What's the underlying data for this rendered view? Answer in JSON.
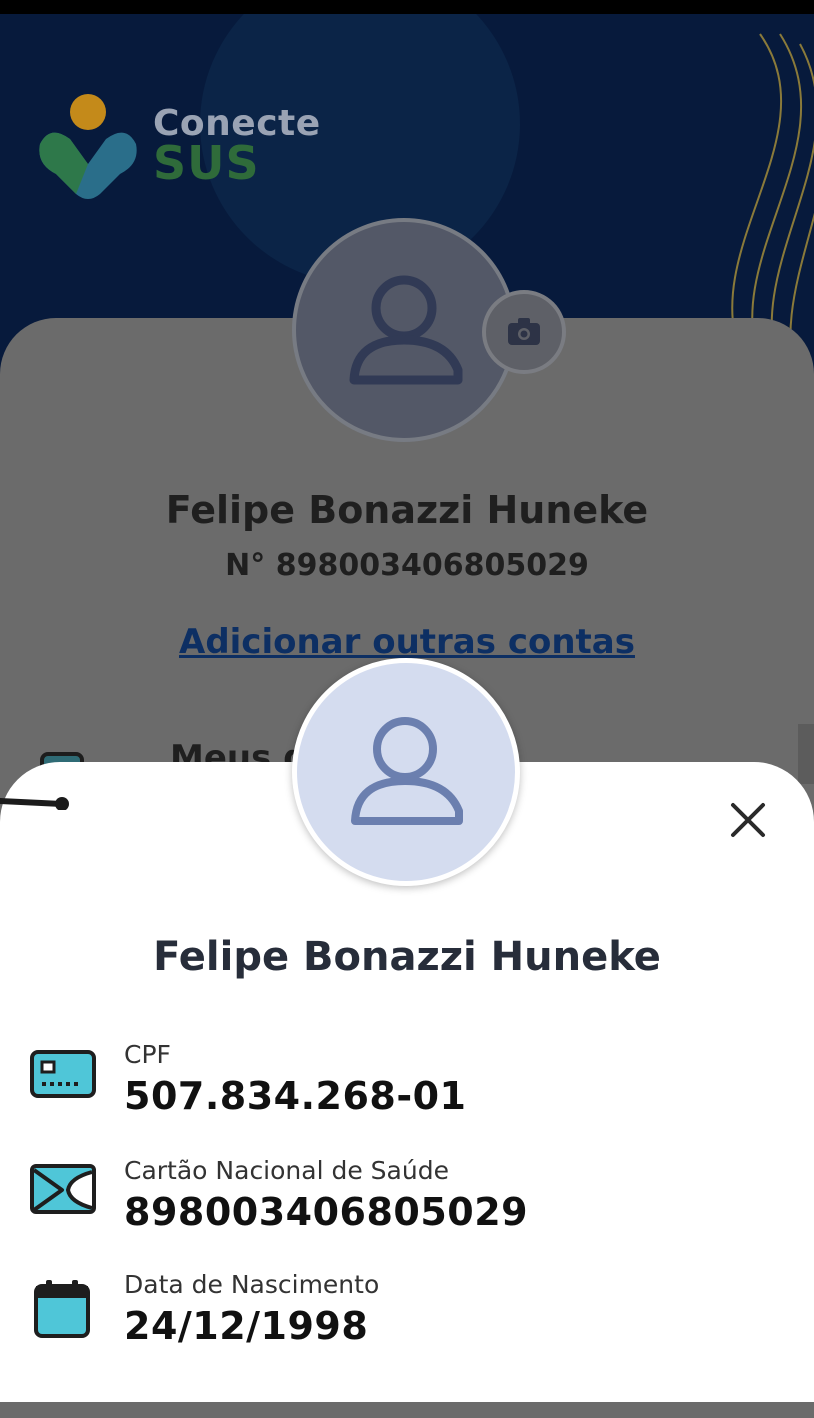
{
  "app": {
    "logo_line1": "Conecte",
    "logo_line2": "SUS"
  },
  "background_profile": {
    "name": "Felipe Bonazzi Huneke",
    "number": "N° 898003406805029",
    "add_accounts_link": "Adicionar outras contas",
    "section_partial": "Meus d"
  },
  "sheet": {
    "name": "Felipe Bonazzi Huneke",
    "fields": [
      {
        "label": "CPF",
        "value": "507.834.268-01",
        "icon": "id-card-icon"
      },
      {
        "label": "Cartão Nacional de Saúde",
        "value": "898003406805029",
        "icon": "health-card-icon"
      },
      {
        "label": "Data de Nascimento",
        "value": "24/12/1998",
        "icon": "calendar-icon"
      }
    ]
  },
  "colors": {
    "header_bg": "#071a3c",
    "overlay_card": "#6b6b6b",
    "avatar_bg": "#d4dcef",
    "icon_accent": "#4fc6d8",
    "link": "#0d2f63"
  }
}
